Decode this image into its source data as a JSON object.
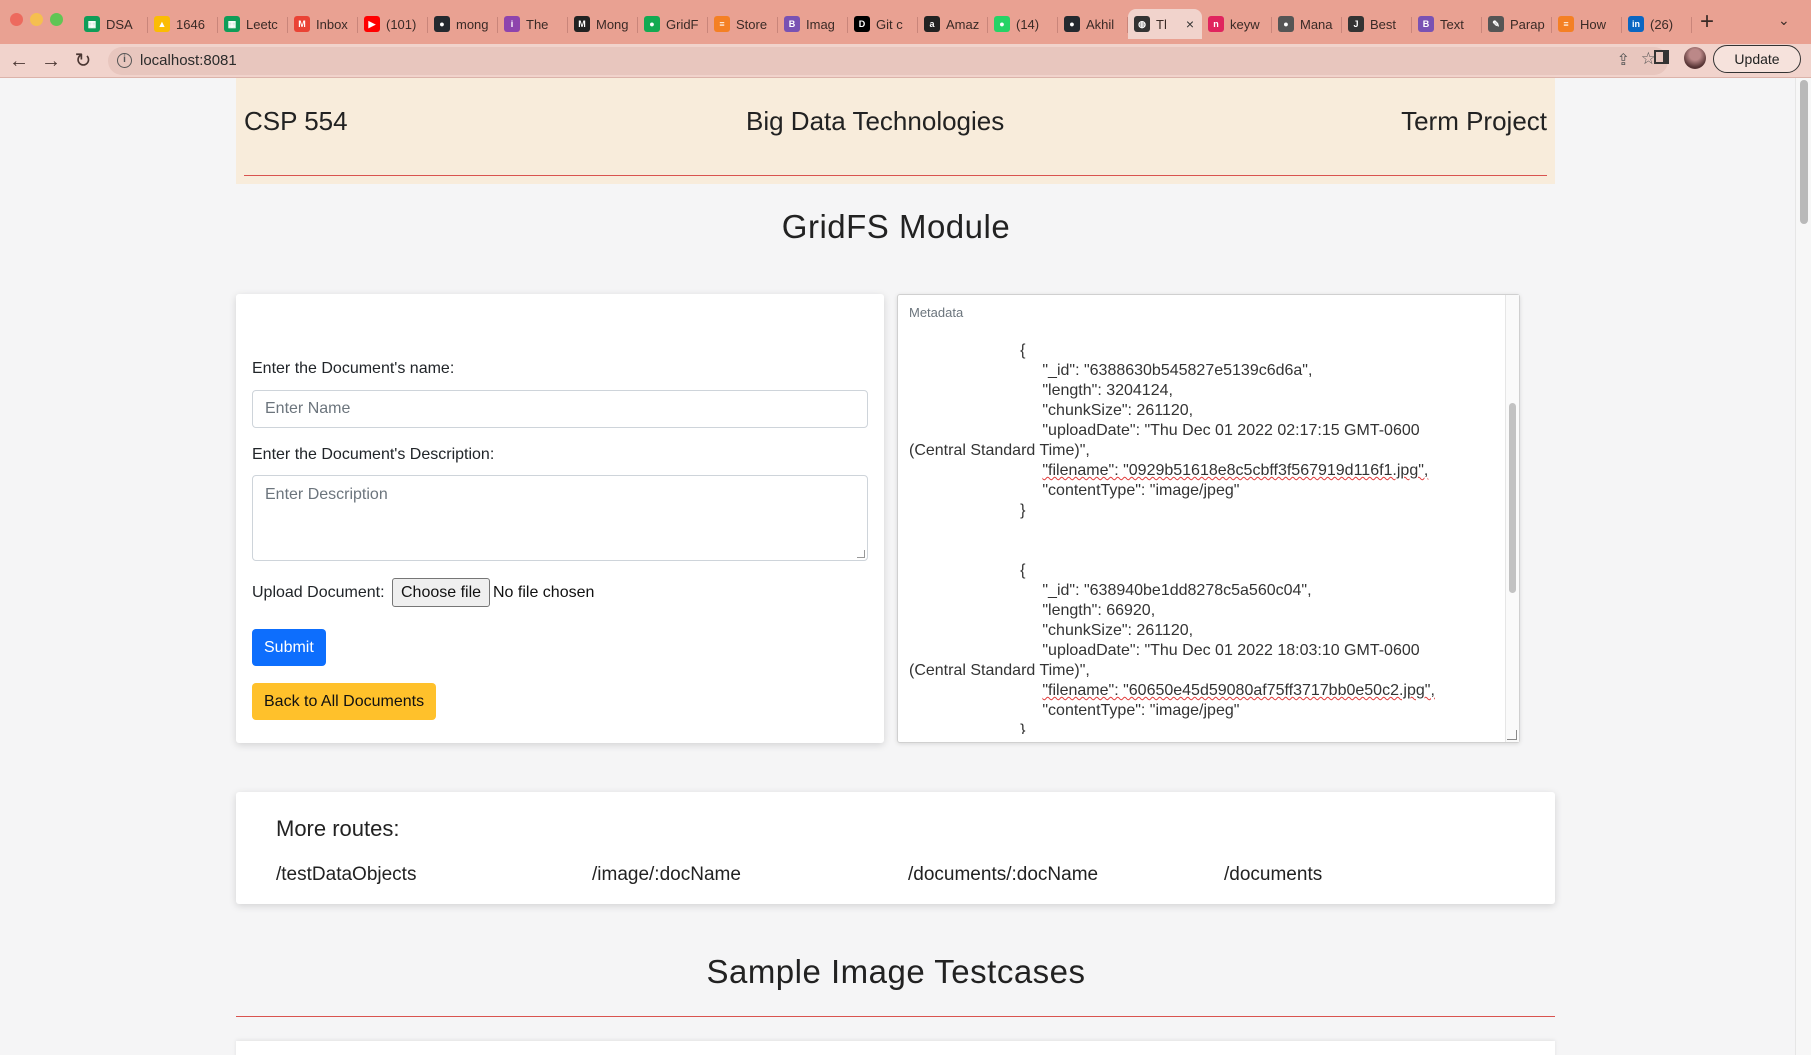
{
  "browser": {
    "url": "localhost:8081",
    "update_label": "Update",
    "tabs": [
      {
        "label": "DSA",
        "icon": "sheets-icon",
        "color": "#0f9d58",
        "glyph": "▦"
      },
      {
        "label": "1646",
        "icon": "drive-icon",
        "color": "#fbbc04",
        "glyph": "▲"
      },
      {
        "label": "Leetc",
        "icon": "sheets-icon",
        "color": "#0f9d58",
        "glyph": "▦"
      },
      {
        "label": "Inbox",
        "icon": "gmail-icon",
        "color": "#ea4335",
        "glyph": "M"
      },
      {
        "label": "(101)",
        "icon": "youtube-icon",
        "color": "#ff0000",
        "glyph": "▶"
      },
      {
        "label": "mong",
        "icon": "github-icon",
        "color": "#24292f",
        "glyph": "●"
      },
      {
        "label": "The",
        "icon": "site-icon",
        "color": "#8e44ad",
        "glyph": "i"
      },
      {
        "label": "Mong",
        "icon": "medium-icon",
        "color": "#222222",
        "glyph": "M"
      },
      {
        "label": "GridF",
        "icon": "mongodb-icon",
        "color": "#13aa52",
        "glyph": "●"
      },
      {
        "label": "Store",
        "icon": "stack-icon",
        "color": "#f48024",
        "glyph": "≡"
      },
      {
        "label": "Imag",
        "icon": "bootstrap-icon",
        "color": "#7952b3",
        "glyph": "B"
      },
      {
        "label": "Git c",
        "icon": "dev-icon",
        "color": "#000000",
        "glyph": "D"
      },
      {
        "label": "Amaz",
        "icon": "amazon-icon",
        "color": "#222222",
        "glyph": "a"
      },
      {
        "label": "(14)",
        "icon": "whatsapp-icon",
        "color": "#25d366",
        "glyph": "●"
      },
      {
        "label": "Akhil",
        "icon": "github-icon",
        "color": "#24292f",
        "glyph": "●"
      },
      {
        "label": "Tl",
        "icon": "globe-icon",
        "color": "#333333",
        "glyph": "◍",
        "active": true
      },
      {
        "label": "keyw",
        "icon": "site-icon",
        "color": "#e0245e",
        "glyph": "n"
      },
      {
        "label": "Mana",
        "icon": "apple-icon",
        "color": "#555555",
        "glyph": "●"
      },
      {
        "label": "Best",
        "icon": "jf-icon",
        "color": "#333333",
        "glyph": "J"
      },
      {
        "label": "Text",
        "icon": "bootstrap-icon",
        "color": "#7952b3",
        "glyph": "B"
      },
      {
        "label": "Parap",
        "icon": "quill-icon",
        "color": "#555555",
        "glyph": "✎"
      },
      {
        "label": "How",
        "icon": "stack-icon",
        "color": "#f48024",
        "glyph": "≡"
      },
      {
        "label": "(26)",
        "icon": "linkedin-icon",
        "color": "#0a66c2",
        "glyph": "in"
      }
    ]
  },
  "header": {
    "left": "CSP 554",
    "center": "Big Data Technologies",
    "right": "Term Project"
  },
  "page": {
    "title": "GridFS Module"
  },
  "form": {
    "name_label": "Enter the Document's name:",
    "name_placeholder": "Enter Name",
    "desc_label": "Enter the Document's Description:",
    "desc_placeholder": "Enter Description",
    "upload_label": "Upload Document:",
    "choose_file": "Choose file",
    "file_status": "No file chosen",
    "submit": "Submit",
    "back": "Back to All Documents"
  },
  "metadata": {
    "label": "Metadata",
    "records": [
      {
        "id_line": "\"_id\": \"6388630b545827e5139c6d6a\",",
        "length_line": "\"length\": 3204124,",
        "chunk_line": "\"chunkSize\": 261120,",
        "upload_line": "\"uploadDate\": \"Thu Dec 01 2022 02:17:15 GMT-0600",
        "upload_cont": "(Central Standard Time)\",",
        "filename_line": "\"filename\": \"0929b51618e8c5cbff3f567919d116f1.jpg\",",
        "type_line": "\"contentType\": \"image/jpeg\""
      },
      {
        "id_line": "\"_id\": \"638940be1dd8278c5a560c04\",",
        "length_line": "\"length\": 66920,",
        "chunk_line": "\"chunkSize\": 261120,",
        "upload_line": "\"uploadDate\": \"Thu Dec 01 2022 18:03:10 GMT-0600",
        "upload_cont": "(Central Standard Time)\",",
        "filename_line": "\"filename\": \"60650e45d59080af75ff3717bb0e50c2.jpg\",",
        "type_line": "\"contentType\": \"image/jpeg\""
      }
    ]
  },
  "routes": {
    "title": "More routes:",
    "items": [
      "/testDataObjects",
      "/image/:docName",
      "/documents/:docName",
      "/documents"
    ]
  },
  "samples": {
    "title": "Sample Image Testcases"
  }
}
